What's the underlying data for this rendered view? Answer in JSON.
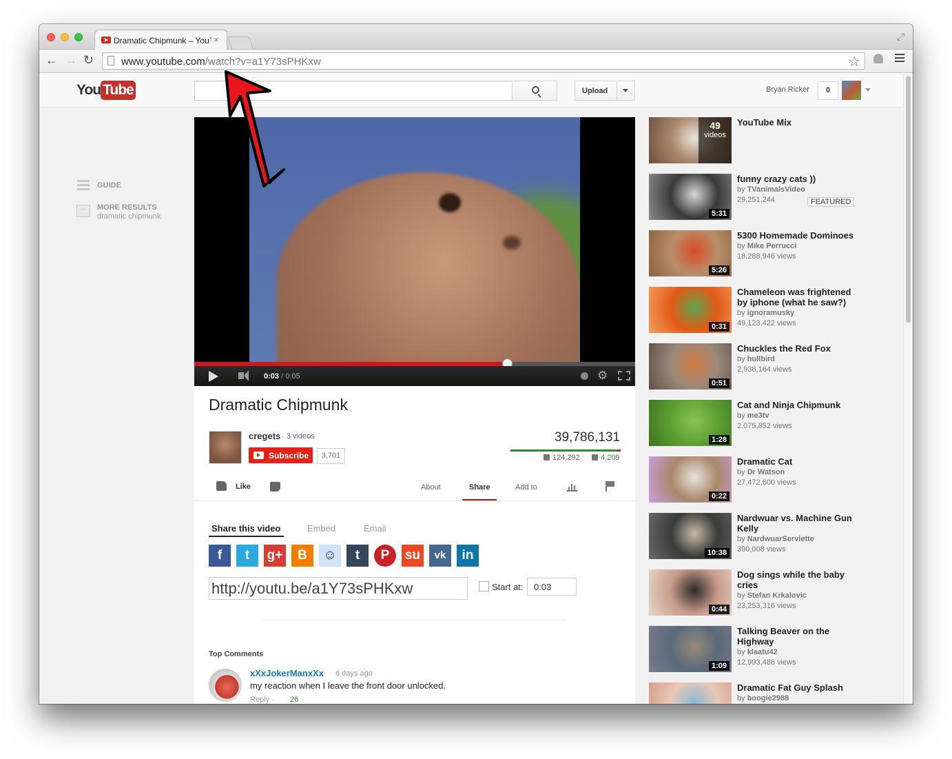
{
  "browser": {
    "tab_title": "Dramatic Chipmunk – YouTube",
    "tab_close": "×",
    "url_host": "www.youtube.com",
    "url_path": "/watch?v=a1Y73sPHKxw",
    "star": "☆",
    "back": "←",
    "forward": "→",
    "reload": "↻",
    "fullscreen": "⤢"
  },
  "masthead": {
    "logo_you": "You",
    "logo_tube": "Tube",
    "search_value": "",
    "upload_label": "Upload",
    "user_name": "Bryan Ricker",
    "notification_count": "0"
  },
  "guide": {
    "guide_label": "GUIDE",
    "more_label": "MORE RESULTS",
    "more_query": "dramatic chipmunk",
    "more_icon": "···"
  },
  "player": {
    "time_current": "0:03",
    "time_total": " / 0:05",
    "progress_fraction": 0.71,
    "settings": "⚙"
  },
  "video": {
    "title": "Dramatic Chipmunk",
    "channel_name": "cregets",
    "channel_videos": "· 3 videos",
    "subscribe_label": "Subscribe",
    "subscriber_count": "3,701",
    "view_count": "39,786,131",
    "like_count": "124,292",
    "dislike_count": "4,209",
    "like_fraction": 0.967
  },
  "actions": {
    "like_label": "Like",
    "tab_about": "About",
    "tab_share": "Share",
    "tab_addto": "Add to"
  },
  "share": {
    "tab_share_video": "Share this video",
    "tab_embed": "Embed",
    "tab_email": "Email",
    "short_url": "http://youtu.be/a1Y73sPHKxw",
    "start_at_label": "Start at:",
    "start_at_value": "0:03",
    "social": [
      {
        "name": "facebook",
        "glyph": "f",
        "color": "#3b5998"
      },
      {
        "name": "twitter",
        "glyph": "t",
        "color": "#2ba9e1"
      },
      {
        "name": "googleplus",
        "glyph": "g+",
        "color": "#d73d32"
      },
      {
        "name": "blogger",
        "glyph": "B",
        "color": "#f57d00"
      },
      {
        "name": "reddit",
        "glyph": "☺",
        "color": "#cee3f8"
      },
      {
        "name": "tumblr",
        "glyph": "t",
        "color": "#35465c"
      },
      {
        "name": "pinterest",
        "glyph": "P",
        "color": "#cb2027"
      },
      {
        "name": "stumbleupon",
        "glyph": "su",
        "color": "#eb4924"
      },
      {
        "name": "vk",
        "glyph": "vk",
        "color": "#45668e"
      },
      {
        "name": "linkedin",
        "glyph": "in",
        "color": "#0e76a8"
      }
    ]
  },
  "comments": {
    "heading": "Top Comments",
    "author": "xXxJokerManxXx",
    "time": "6 days ago",
    "text": "my reaction when I leave the front door unlocked.",
    "reply": "Reply ·",
    "likes": "26"
  },
  "related": [
    {
      "title": "YouTube Mix",
      "by": "",
      "views": "",
      "duration": "",
      "mix_count": "49",
      "mix_label": "videos",
      "colors": [
        "#a9876c",
        "#e9e3dc",
        "#6b5040"
      ]
    },
    {
      "title": "funny crazy cats ))",
      "by": "TVanimalsVideo",
      "views": "29,251,244",
      "duration": "5:31",
      "featured": "FEATURED",
      "colors": [
        "#3a3a3a",
        "#d8d8d8",
        "#8d8d8d"
      ]
    },
    {
      "title": "5300 Homemade Dominoes",
      "by": "Mike Perrucci",
      "views": "18,288,946 views",
      "duration": "5:26",
      "colors": [
        "#b88e6a",
        "#d84a2a",
        "#8a6242"
      ]
    },
    {
      "title": "Chameleon was frightened by iphone (what he saw?)",
      "by": "ignoramusky",
      "views": "49,123,422 views",
      "duration": "0:31",
      "colors": [
        "#e25a18",
        "#5ea34a",
        "#f0a060"
      ]
    },
    {
      "title": "Chuckles the Red Fox",
      "by": "hullbird",
      "views": "2,938,164 views",
      "duration": "0:51",
      "colors": [
        "#9a8a7a",
        "#d07a40",
        "#5b5048"
      ]
    },
    {
      "title": "Cat and Ninja Chipmunk",
      "by": "me3tv",
      "views": "2,075,852 views",
      "duration": "1:28",
      "colors": [
        "#5ea034",
        "#8cc455",
        "#3d7420"
      ]
    },
    {
      "title": "Dramatic Cat",
      "by": "Dr Watson",
      "views": "27,472,600 views",
      "duration": "0:22",
      "colors": [
        "#a9876c",
        "#e9e3dc",
        "#c9a0e0"
      ]
    },
    {
      "title": "Nardwuar vs. Machine Gun Kelly",
      "by": "NardwuarServiette",
      "views": "390,008 views",
      "duration": "10:38",
      "colors": [
        "#3a3a3a",
        "#c8b8a8",
        "#6a6a6a"
      ]
    },
    {
      "title": "Dog sings while the baby cries",
      "by": "Stefan Krkalovic",
      "views": "23,253,316 views",
      "duration": "0:44",
      "colors": [
        "#c89a8a",
        "#2a2a2a",
        "#e8d8c8"
      ]
    },
    {
      "title": "Talking Beaver on the Highway",
      "by": "klaatu42",
      "views": "12,993,488 views",
      "duration": "1:09",
      "colors": [
        "#5a6a7a",
        "#9a8a7a",
        "#7a7a8a"
      ]
    },
    {
      "title": "Dramatic Fat Guy Splash",
      "by": "boogie2988",
      "views": "",
      "duration": "",
      "colors": [
        "#e8c8b8",
        "#8ab8d8",
        "#d89888"
      ]
    }
  ]
}
